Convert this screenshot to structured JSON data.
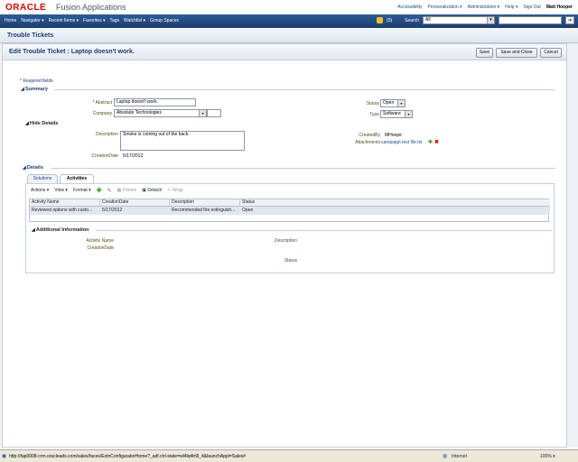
{
  "header": {
    "logo": "ORACLE",
    "app_name": "Fusion Applications",
    "links": [
      "Accessibility",
      "Personalization ▾",
      "Administration ▾",
      "Help ▾",
      "Sign Out"
    ],
    "user": "Matt Hooper"
  },
  "nav": {
    "items": [
      "Home",
      "Navigator ▾",
      "Recent Items ▾",
      "Favorites ▾",
      "Tags",
      "Watchlist ▾",
      "Group Spaces"
    ],
    "notifications": "(0)",
    "search_label": "Search",
    "search_scope": "All"
  },
  "page_title": "Trouble Tickets",
  "edit": {
    "title": "Edit Trouble Ticket : Laptop doesn't work.",
    "buttons": {
      "save": "Save",
      "save_close": "Save and Close",
      "cancel": "Cancel"
    }
  },
  "required_note": "* Required fields",
  "summary": {
    "heading": "Summary",
    "abstract_label": "Abstract",
    "abstract_value": "Laptop doesn't work.",
    "company_label": "Company",
    "company_value": "Absolute Technologies",
    "status_label": "Status",
    "status_value": "Open",
    "type_label": "Type",
    "type_value": "Software"
  },
  "details_toggle": {
    "heading": "Hide Details",
    "description_label": "Description",
    "description_value": "Smoke is coming out of the back.",
    "creation_date_label": "CreationDate",
    "creation_date_value": "5/17/2012",
    "created_by_label": "CreatedBy",
    "created_by_value": "MHoope",
    "attachments_label": "Attachments",
    "attachments_value": "campaign test file.txt"
  },
  "details_section": {
    "heading": "Details",
    "tabs": [
      "Solutions",
      "Activities"
    ],
    "toolbar": {
      "actions": "Actions ▾",
      "view": "View ▾",
      "format": "Format ▾",
      "freeze": "Freeze",
      "detach": "Detach",
      "wrap": "Wrap"
    },
    "columns": [
      "Activity Name",
      "CreationDate",
      "Description",
      "Status"
    ],
    "rows": [
      [
        "Reviewed options with custo...",
        "5/17/2012",
        "Recommended fire extinguish...",
        "Open"
      ]
    ]
  },
  "additional_info": {
    "heading": "Additional Information",
    "activity_name_label": "Activity Name",
    "creation_date_label": "CreationDate",
    "description_label": "Description",
    "status_label": "Status"
  },
  "statusbar": {
    "url": "http://fap0008-crm.oracleads.com/sales/faces/ExtnConfiguratorHome?_adf.ctrl-state=wl4lq4tr9l_4&launchAppl=Sales#",
    "zone": "Internet",
    "zoom": "100% ▾"
  },
  "colors": {
    "nav": "#1b3e70",
    "accent": "#d00000",
    "label": "#5b4a1a"
  }
}
